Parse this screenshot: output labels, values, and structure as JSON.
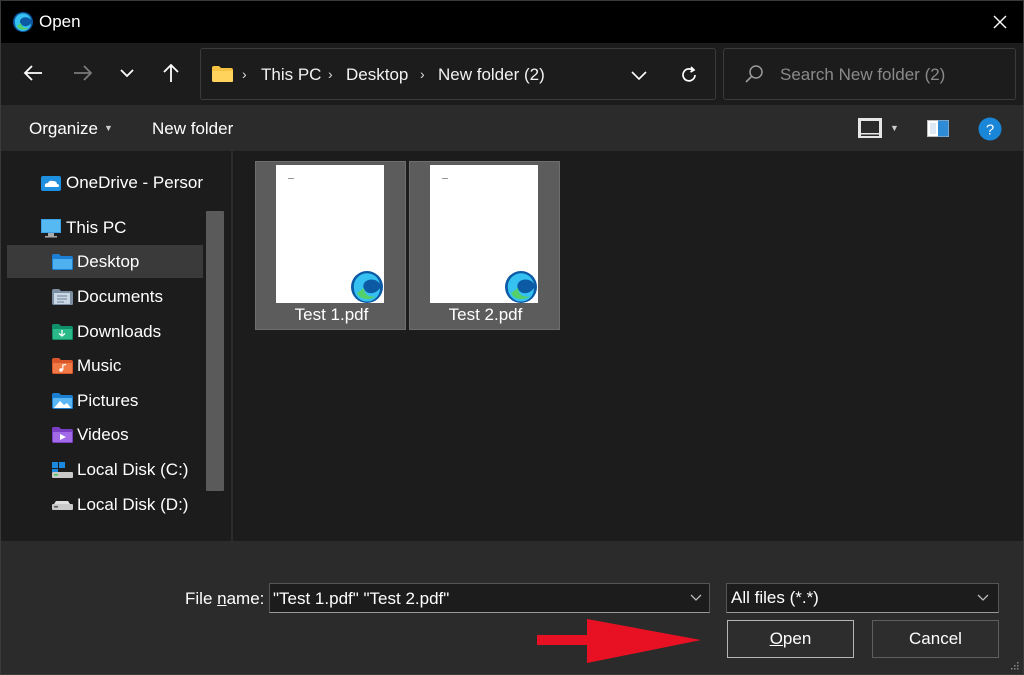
{
  "window": {
    "title": "Open"
  },
  "navigation": {
    "breadcrumbs": [
      "This PC",
      "Desktop",
      "New folder (2)"
    ],
    "search_placeholder": "Search New folder (2)"
  },
  "commandbar": {
    "organize_label": "Organize",
    "new_folder_label": "New folder"
  },
  "sidebar": {
    "items": [
      {
        "label": "OneDrive - Persor",
        "icon": "onedrive-icon",
        "level": 0
      },
      {
        "label": "This PC",
        "icon": "pc-icon",
        "level": 0
      },
      {
        "label": "Desktop",
        "icon": "desktop-folder-icon",
        "level": 1,
        "selected": true
      },
      {
        "label": "Documents",
        "icon": "documents-folder-icon",
        "level": 1
      },
      {
        "label": "Downloads",
        "icon": "downloads-folder-icon",
        "level": 1
      },
      {
        "label": "Music",
        "icon": "music-folder-icon",
        "level": 1
      },
      {
        "label": "Pictures",
        "icon": "pictures-folder-icon",
        "level": 1
      },
      {
        "label": "Videos",
        "icon": "videos-folder-icon",
        "level": 1
      },
      {
        "label": "Local Disk (C:)",
        "icon": "local-disk-c-icon",
        "level": 1
      },
      {
        "label": "Local Disk (D:)",
        "icon": "local-disk-d-icon",
        "level": 1
      }
    ]
  },
  "files": [
    {
      "name": "Test 1.pdf",
      "selected": true,
      "icon": "edge-pdf-icon"
    },
    {
      "name": "Test 2.pdf",
      "selected": true,
      "icon": "edge-pdf-icon"
    }
  ],
  "footer": {
    "file_name_label_pre": "File ",
    "file_name_label_accel": "n",
    "file_name_label_post": "ame:",
    "file_name_value": "\"Test 1.pdf\" \"Test 2.pdf\"",
    "file_type_value": "All files (*.*)",
    "open_accel": "O",
    "open_rest": "pen",
    "cancel_label": "Cancel"
  },
  "colors": {
    "accent_blue": "#0078d4",
    "annotation_red": "#e81123",
    "folder_yellow": "#f7c948"
  }
}
